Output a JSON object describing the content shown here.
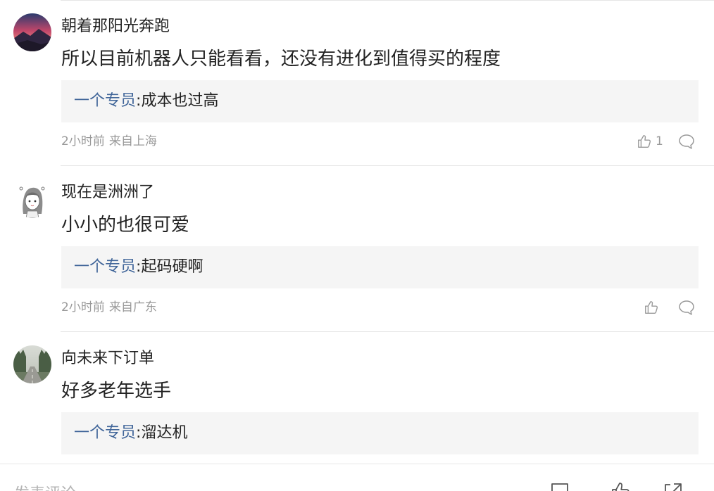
{
  "comments": [
    {
      "user": "朝着那阳光奔跑",
      "avatar": "sunset-landscape-avatar",
      "text": "所以目前机器人只能看看，还没有进化到值得买的程度",
      "reply": {
        "author": "一个专员",
        "separator": ":",
        "text": "成本也过高"
      },
      "time": "2小时前",
      "location": "来自上海",
      "likes": "1"
    },
    {
      "user": "现在是洲洲了",
      "avatar": "anime-girl-avatar",
      "text": "小小的也很可爱",
      "reply": {
        "author": "一个专员",
        "separator": ":",
        "text": "起码硬啊"
      },
      "time": "2小时前",
      "location": "来自广东",
      "likes": ""
    },
    {
      "user": "向未来下订单",
      "avatar": "forest-road-avatar",
      "text": "好多老年选手",
      "reply": {
        "author": "一个专员",
        "separator": ":",
        "text": "溜达机"
      }
    }
  ],
  "bottom_bar": {
    "placeholder": "发表评论",
    "icons": [
      "comment-icon",
      "like-icon",
      "share-icon"
    ]
  },
  "colors": {
    "reply_author": "#406599",
    "meta": "#999999",
    "reply_bg": "#f5f5f5",
    "divider": "#e6e6e6"
  }
}
